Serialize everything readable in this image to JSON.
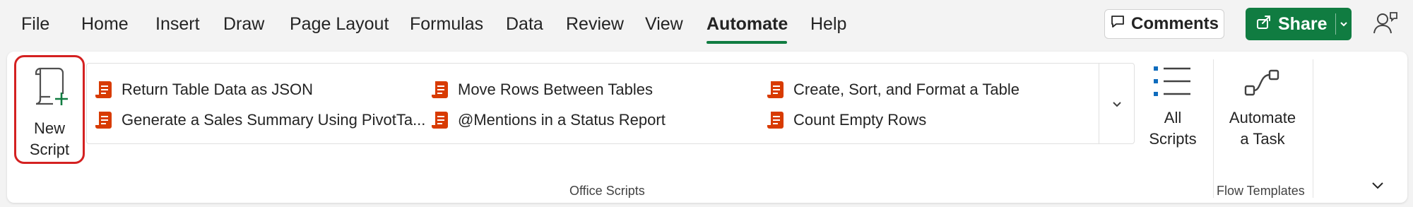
{
  "tabs": [
    {
      "label": "File"
    },
    {
      "label": "Home"
    },
    {
      "label": "Insert"
    },
    {
      "label": "Draw"
    },
    {
      "label": "Page Layout"
    },
    {
      "label": "Formulas"
    },
    {
      "label": "Data"
    },
    {
      "label": "Review"
    },
    {
      "label": "View"
    },
    {
      "label": "Automate",
      "active": true
    },
    {
      "label": "Help"
    }
  ],
  "header": {
    "comments_label": "Comments",
    "share_label": "Share"
  },
  "ribbon": {
    "new_script": {
      "line1": "New",
      "line2": "Script"
    },
    "scripts": [
      {
        "label": "Return Table Data as JSON"
      },
      {
        "label": "Generate a Sales Summary Using PivotTa..."
      },
      {
        "label": "Move Rows Between Tables"
      },
      {
        "label": "@Mentions in a Status Report"
      },
      {
        "label": "Create, Sort, and Format a Table"
      },
      {
        "label": "Count Empty Rows"
      }
    ],
    "all_scripts": {
      "line1": "All",
      "line2": "Scripts"
    },
    "automate_task": {
      "line1": "Automate",
      "line2": "a Task"
    },
    "group_office_scripts": "Office Scripts",
    "group_flow_templates": "Flow Templates"
  },
  "colors": {
    "accent_green": "#107c41",
    "highlight_red": "#d42121",
    "script_icon_orange": "#d83b01"
  }
}
